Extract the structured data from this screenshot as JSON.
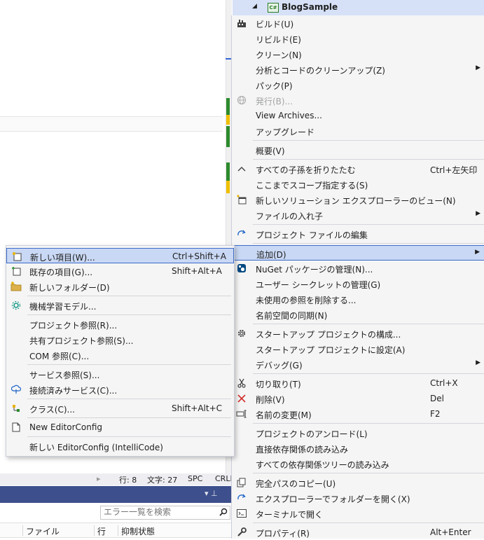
{
  "solution_explorer": {
    "project_name": "BlogSample",
    "project_badge": "C#"
  },
  "context_menu": {
    "items": [
      {
        "label": "ビルド(U)",
        "icon": "build-icon"
      },
      {
        "label": "リビルド(E)"
      },
      {
        "label": "クリーン(N)"
      },
      {
        "label": "分析とコードのクリーンアップ(Z)",
        "submenu": true
      },
      {
        "label": "パック(P)"
      },
      {
        "label": "発行(B)...",
        "disabled": true,
        "icon": "globe-publish-icon"
      },
      {
        "label": "View Archives..."
      },
      {
        "label": "アップグレード"
      },
      {
        "label": "概要(V)"
      },
      {
        "label": "すべての子孫を折りたたむ",
        "shortcut": "Ctrl+左矢印",
        "icon": "collapse-icon"
      },
      {
        "label": "ここまでスコープ指定する(S)"
      },
      {
        "label": "新しいソリューション エクスプローラーのビュー(N)",
        "icon": "new-view-icon"
      },
      {
        "label": "ファイルの入れ子",
        "submenu": true
      },
      {
        "label": "プロジェクト ファイルの編集",
        "icon": "edit-project-icon"
      },
      {
        "label": "追加(D)",
        "submenu": true,
        "highlighted": true
      },
      {
        "label": "NuGet パッケージの管理(N)...",
        "icon": "nuget-icon"
      },
      {
        "label": "ユーザー シークレットの管理(G)"
      },
      {
        "label": "未使用の参照を削除する..."
      },
      {
        "label": "名前空間の同期(N)"
      },
      {
        "label": "スタートアップ プロジェクトの構成...",
        "icon": "gear-icon"
      },
      {
        "label": "スタートアップ プロジェクトに設定(A)"
      },
      {
        "label": "デバッグ(G)",
        "submenu": true
      },
      {
        "label": "切り取り(T)",
        "shortcut": "Ctrl+X",
        "icon": "cut-icon"
      },
      {
        "label": "削除(V)",
        "shortcut": "Del",
        "icon": "delete-icon"
      },
      {
        "label": "名前の変更(M)",
        "shortcut": "F2",
        "icon": "rename-icon"
      },
      {
        "label": "プロジェクトのアンロード(L)"
      },
      {
        "label": "直接依存関係の読み込み"
      },
      {
        "label": "すべての依存関係ツリーの読み込み"
      },
      {
        "label": "完全パスのコピー(U)",
        "icon": "copy-path-icon"
      },
      {
        "label": "エクスプローラーでフォルダーを開く(X)",
        "icon": "open-folder-icon"
      },
      {
        "label": "ターミナルで開く",
        "icon": "terminal-icon"
      },
      {
        "label": "プロパティ(R)",
        "shortcut": "Alt+Enter",
        "icon": "wrench-icon"
      }
    ]
  },
  "add_submenu": {
    "items": [
      {
        "label": "新しい項目(W)...",
        "shortcut": "Ctrl+Shift+A",
        "icon": "new-item-icon",
        "highlighted": true
      },
      {
        "label": "既存の項目(G)...",
        "shortcut": "Shift+Alt+A",
        "icon": "existing-item-icon"
      },
      {
        "label": "新しいフォルダー(D)",
        "icon": "new-folder-icon"
      },
      {
        "label": "機械学習モデル...",
        "icon": "ml-model-icon"
      },
      {
        "label": "プロジェクト参照(R)..."
      },
      {
        "label": "共有プロジェクト参照(S)..."
      },
      {
        "label": "COM 参照(C)..."
      },
      {
        "label": "サービス参照(S)..."
      },
      {
        "label": "接続済みサービス(C)...",
        "icon": "connected-service-icon"
      },
      {
        "label": "クラス(C)...",
        "shortcut": "Shift+Alt+C",
        "icon": "class-icon"
      },
      {
        "label": "New EditorConfig",
        "icon": "file-icon"
      },
      {
        "label": "新しい EditorConfig (IntelliCode)"
      }
    ]
  },
  "status_bar": {
    "line": "行: 8",
    "char": "文字: 27",
    "spc": "SPC",
    "crlf": "CRLF"
  },
  "error_list": {
    "search_placeholder": "エラー一覧を検索",
    "pin_glyph": "▾ ⊥",
    "columns": [
      "ファイル",
      "行",
      "抑制状態"
    ]
  },
  "colors": {
    "highlight": "#c9d8f4",
    "highlight_border": "#3d6bc9",
    "menu_bg": "#f5f5f5",
    "panel_title": "#3d4f8c"
  }
}
